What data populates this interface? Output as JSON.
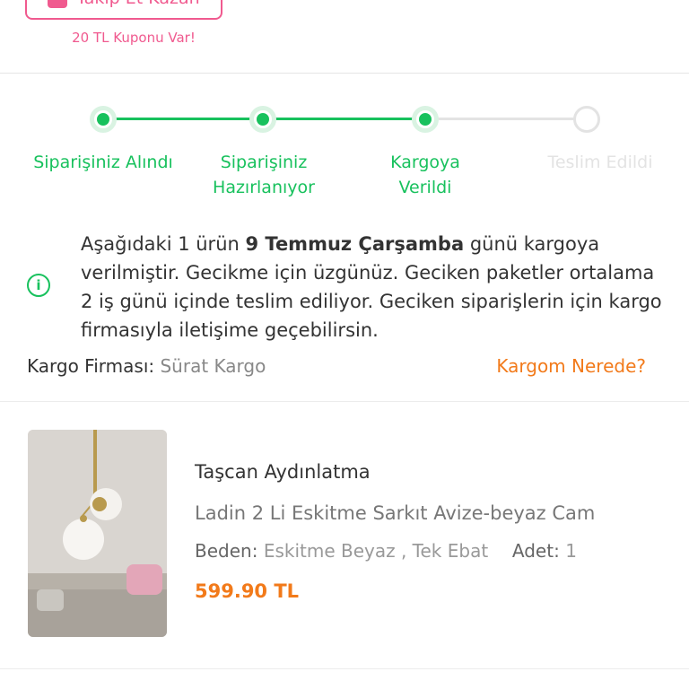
{
  "follow": {
    "label": "Takip Et Kazan",
    "coupon": "20 TL Kuponu Var!"
  },
  "steps": [
    {
      "label": "Siparişiniz Alındı",
      "status": "done"
    },
    {
      "label": "Siparişiniz Hazırlanıyor",
      "status": "done"
    },
    {
      "label": "Kargoya Verildi",
      "status": "done"
    },
    {
      "label": "Teslim Edildi",
      "status": "pending"
    }
  ],
  "info": {
    "prefix": "Aşağıdaki 1 ürün ",
    "date": "9 Temmuz Çarşamba",
    "suffix": " günü kargoya verilmiştir. Gecikme için üzgünüz. Geciken paketler ortalama 2 iş günü içinde teslim ediliyor. Geciken siparişlerin için kargo firmasıyla iletişime geçebilirsin."
  },
  "cargo": {
    "label": "Kargo Firması:",
    "value": "Sürat Kargo",
    "link": "Kargom Nerede?"
  },
  "product": {
    "brand": "Taşcan Aydınlatma",
    "name": "Ladin 2 Li Eskitme Sarkıt Avize-beyaz Cam",
    "size_label": "Beden:",
    "size_value": "Eskitme Beyaz , Tek Ebat",
    "qty_label": "Adet:",
    "qty_value": "1",
    "price": "599.90 TL"
  },
  "colors": {
    "green": "#18c15d",
    "pink": "#f05a8f",
    "orange": "#f27a1a",
    "grey": "#e3e3e3"
  }
}
